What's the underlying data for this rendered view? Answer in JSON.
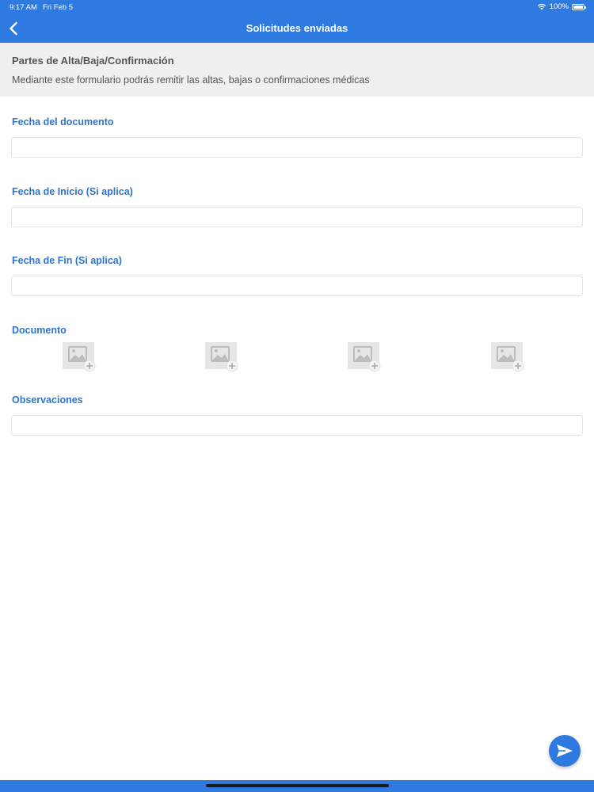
{
  "status_bar": {
    "time": "9:17 AM",
    "date": "Fri Feb 5",
    "battery": "100%"
  },
  "nav": {
    "title": "Solicitudes enviadas",
    "back_icon": "chevron-left-icon"
  },
  "intro": {
    "title": "Partes de Alta/Baja/Confirmación",
    "description": "Mediante este formulario podrás remitir las altas, bajas o confirmaciones médicas"
  },
  "form": {
    "fecha_documento": {
      "label": "Fecha del documento",
      "value": ""
    },
    "fecha_inicio": {
      "label": "Fecha de Inicio (Si aplica)",
      "value": ""
    },
    "fecha_fin": {
      "label": "Fecha de Fin (Si aplica)",
      "value": ""
    },
    "documento": {
      "label": "Documento",
      "slots": [
        {
          "icon": "add-image-icon"
        },
        {
          "icon": "add-image-icon"
        },
        {
          "icon": "add-image-icon"
        },
        {
          "icon": "add-image-icon"
        }
      ]
    },
    "observaciones": {
      "label": "Observaciones",
      "value": ""
    }
  },
  "fab": {
    "icon": "send-icon"
  },
  "colors": {
    "primary": "#2f7ae0",
    "label": "#2f74c9",
    "intro_bg": "#f0f0f0",
    "field_border": "#e2e2e2"
  }
}
